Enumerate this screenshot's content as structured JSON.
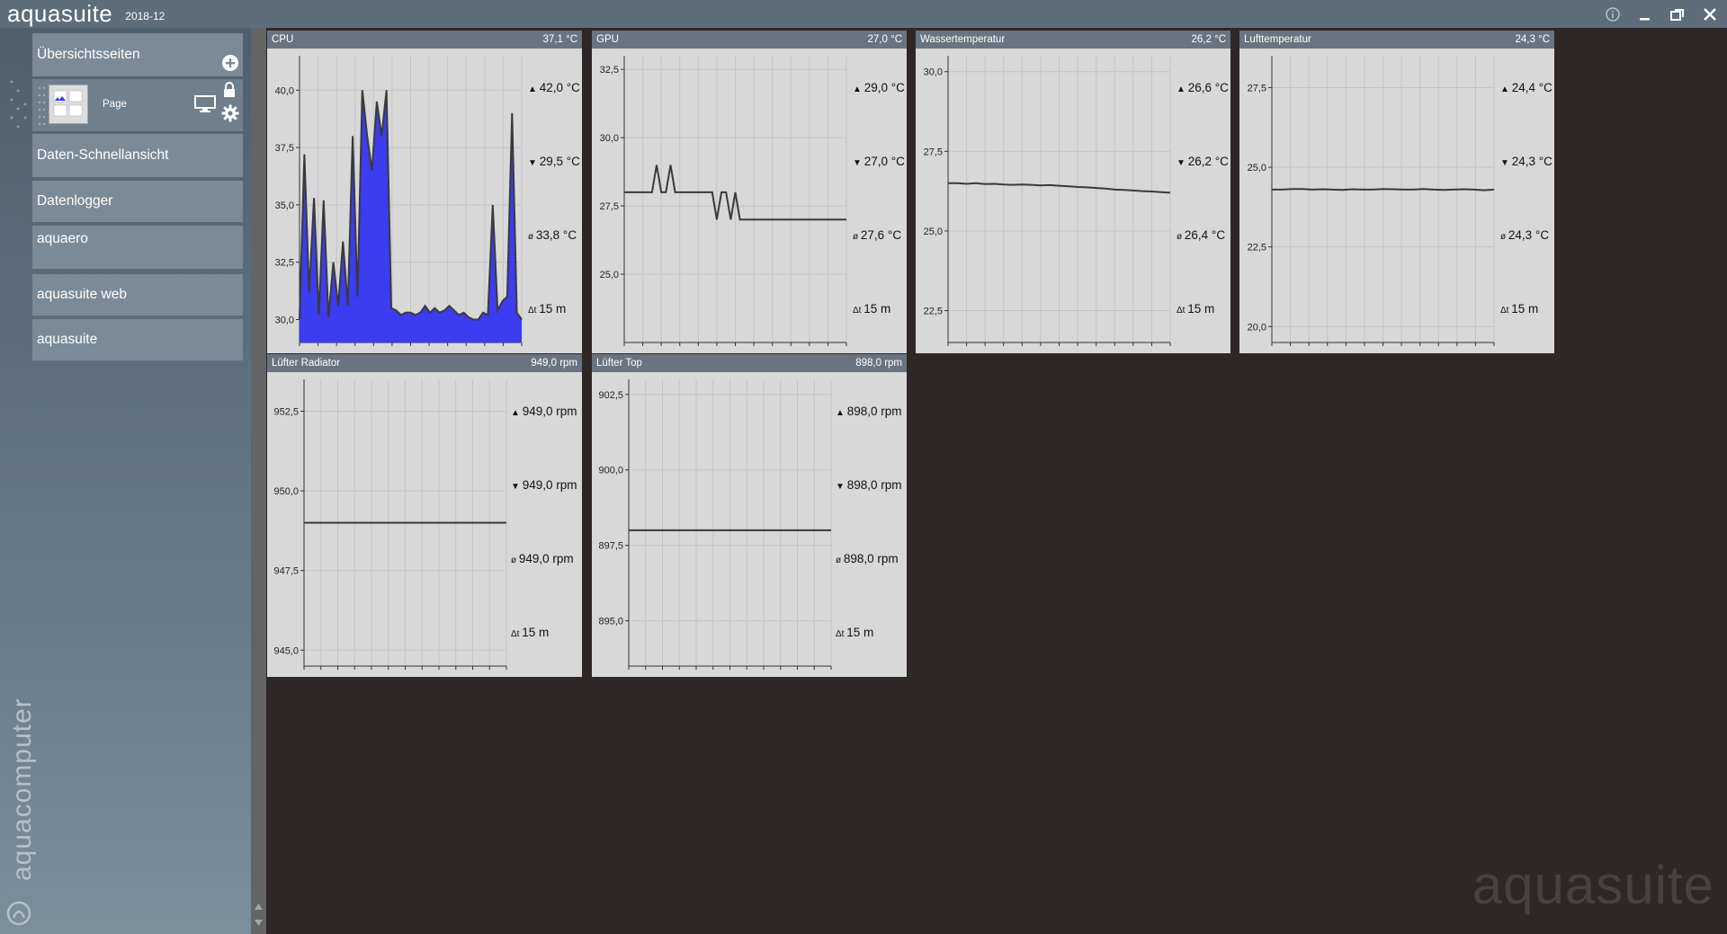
{
  "app": {
    "name": "aquasuite",
    "version": "2018-12"
  },
  "window_controls": [
    "info-icon",
    "minimize-icon",
    "restore-icon",
    "close-icon"
  ],
  "sidebar": {
    "overview_label": "Übersichtsseiten",
    "page_label": "Page",
    "items": [
      "Daten-Schnellansicht",
      "Datenlogger",
      "aquaero",
      "aquasuite web",
      "aquasuite"
    ],
    "brand": "aquacomputer"
  },
  "watermark": "aquasuite",
  "colors": {
    "cpu_fill": "#3c3cf0",
    "panel_bg": "#d8d8d8",
    "panel_head": "#6a7480"
  },
  "chart_data": [
    {
      "id": "cpu",
      "title": "CPU",
      "current": "37,1 °C",
      "type": "area",
      "y_ticks": [
        "40,0",
        "37,5",
        "35,0",
        "32,5",
        "30,0"
      ],
      "ylim": [
        29.0,
        41.5
      ],
      "values": [
        30.0,
        37.2,
        31.2,
        35.3,
        30.2,
        35.2,
        30.1,
        32.5,
        30.6,
        33.4,
        30.6,
        38.0,
        31.0,
        40.0,
        38.0,
        36.5,
        39.5,
        38.0,
        40.0,
        30.5,
        30.4,
        30.2,
        30.3,
        30.3,
        30.2,
        30.3,
        30.6,
        30.3,
        30.5,
        30.3,
        30.4,
        30.6,
        30.4,
        30.2,
        30.3,
        30.1,
        30.0,
        30.0,
        30.3,
        30.2,
        35.0,
        30.4,
        30.8,
        31.0,
        39.0,
        30.3,
        30.0
      ],
      "stats": {
        "max": "42,0 °C",
        "min": "29,5 °C",
        "avg": "33,8 °C",
        "span": "15 m"
      }
    },
    {
      "id": "gpu",
      "title": "GPU",
      "current": "27,0 °C",
      "type": "line",
      "y_ticks": [
        "32,5",
        "30,0",
        "27,5",
        "25,0"
      ],
      "ylim": [
        22.5,
        33.0
      ],
      "values": [
        28.0,
        28.0,
        28.0,
        28.0,
        28.0,
        28.0,
        28.0,
        29.0,
        28.0,
        28.0,
        29.0,
        28.0,
        28.0,
        28.0,
        28.0,
        28.0,
        28.0,
        28.0,
        28.0,
        28.0,
        27.0,
        28.0,
        28.0,
        27.0,
        28.0,
        27.0,
        27.0,
        27.0,
        27.0,
        27.0,
        27.0,
        27.0,
        27.0,
        27.0,
        27.0,
        27.0,
        27.0,
        27.0,
        27.0,
        27.0,
        27.0,
        27.0,
        27.0,
        27.0,
        27.0,
        27.0,
        27.0,
        27.0,
        27.0
      ],
      "stats": {
        "max": "29,0 °C",
        "min": "27,0 °C",
        "avg": "27,6 °C",
        "span": "15 m"
      }
    },
    {
      "id": "water",
      "title": "Wassertemperatur",
      "current": "26,2 °C",
      "type": "line",
      "y_ticks": [
        "30,0",
        "27,5",
        "25,0",
        "22,5"
      ],
      "ylim": [
        21.5,
        30.5
      ],
      "values": [
        26.5,
        26.5,
        26.48,
        26.5,
        26.47,
        26.48,
        26.46,
        26.45,
        26.46,
        26.45,
        26.43,
        26.44,
        26.42,
        26.4,
        26.38,
        26.37,
        26.35,
        26.33,
        26.3,
        26.29,
        26.27,
        26.25,
        26.24,
        26.22,
        26.2
      ],
      "stats": {
        "max": "26,6 °C",
        "min": "26,2 °C",
        "avg": "26,4 °C",
        "span": "15 m"
      }
    },
    {
      "id": "air",
      "title": "Lufttemperatur",
      "current": "24,3 °C",
      "type": "line",
      "y_ticks": [
        "27,5",
        "25,0",
        "22,5",
        "20,0"
      ],
      "ylim": [
        19.5,
        28.5
      ],
      "values": [
        24.3,
        24.3,
        24.32,
        24.32,
        24.3,
        24.31,
        24.3,
        24.29,
        24.31,
        24.3,
        24.3,
        24.32,
        24.31,
        24.3,
        24.3,
        24.32,
        24.3,
        24.29,
        24.3,
        24.31,
        24.3,
        24.28,
        24.3
      ],
      "stats": {
        "max": "24,4 °C",
        "min": "24,3 °C",
        "avg": "24,3 °C",
        "span": "15 m"
      }
    },
    {
      "id": "fan_radiator",
      "title": "Lüfter Radiator",
      "current": "949,0 rpm",
      "type": "line",
      "y_ticks": [
        "952,5",
        "950,0",
        "947,5",
        "945,0"
      ],
      "ylim": [
        944.5,
        953.5
      ],
      "values": [
        949.0,
        949.0
      ],
      "stats": {
        "max": "949,0 rpm",
        "min": "949,0 rpm",
        "avg": "949,0 rpm",
        "span": "15 m"
      }
    },
    {
      "id": "fan_top",
      "title": "Lüfter Top",
      "current": "898,0 rpm",
      "type": "line",
      "y_ticks": [
        "902,5",
        "900,0",
        "897,5",
        "895,0"
      ],
      "ylim": [
        893.5,
        903.0
      ],
      "values": [
        898.0,
        898.0
      ],
      "stats": {
        "max": "898,0 rpm",
        "min": "898,0 rpm",
        "avg": "898,0 rpm",
        "span": "15 m"
      }
    }
  ]
}
